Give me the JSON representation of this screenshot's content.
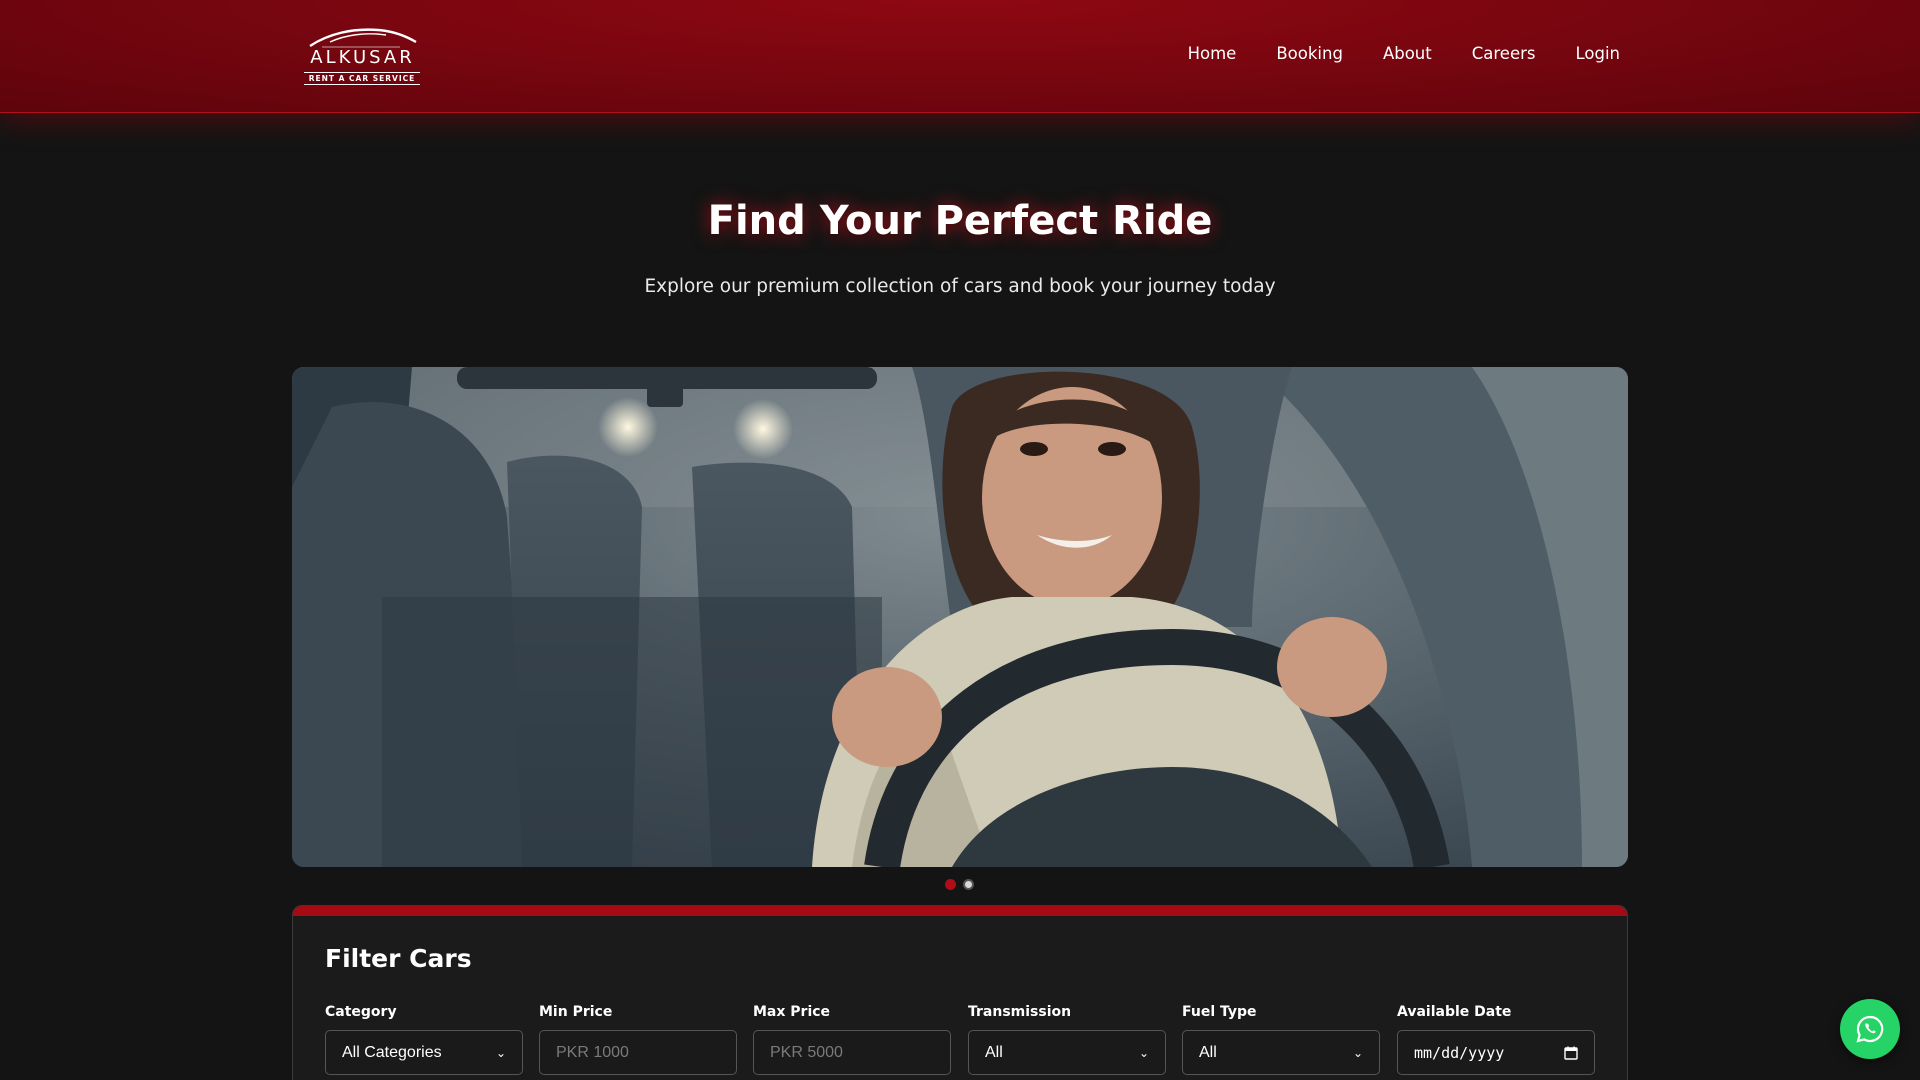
{
  "brand": {
    "name": "ALKUSAR",
    "tagline": "RENT A CAR SERVICE"
  },
  "nav": {
    "items": [
      "Home",
      "Booking",
      "About",
      "Careers",
      "Login"
    ]
  },
  "hero": {
    "title": "Find Your Perfect Ride",
    "subtitle": "Explore our premium collection of cars and book your journey today"
  },
  "slider": {
    "slide_count": 2,
    "active_index": 0
  },
  "filter": {
    "title": "Filter Cars",
    "fields": {
      "category": {
        "label": "Category",
        "value": "All Categories"
      },
      "min_price": {
        "label": "Min Price",
        "placeholder": "PKR 1000"
      },
      "max_price": {
        "label": "Max Price",
        "placeholder": "PKR 5000"
      },
      "transmission": {
        "label": "Transmission",
        "value": "All"
      },
      "fuel_type": {
        "label": "Fuel Type",
        "value": "All"
      },
      "available_date": {
        "label": "Available Date",
        "placeholder": "mm/dd/yyyy"
      }
    }
  },
  "colors": {
    "brand_red": "#8e0812",
    "accent_red": "#a50a15",
    "whatsapp_green": "#25d366",
    "background": "#141414"
  },
  "icons": {
    "whatsapp": "whatsapp-icon",
    "calendar": "calendar-icon",
    "chevron": "chevron-down-icon"
  }
}
